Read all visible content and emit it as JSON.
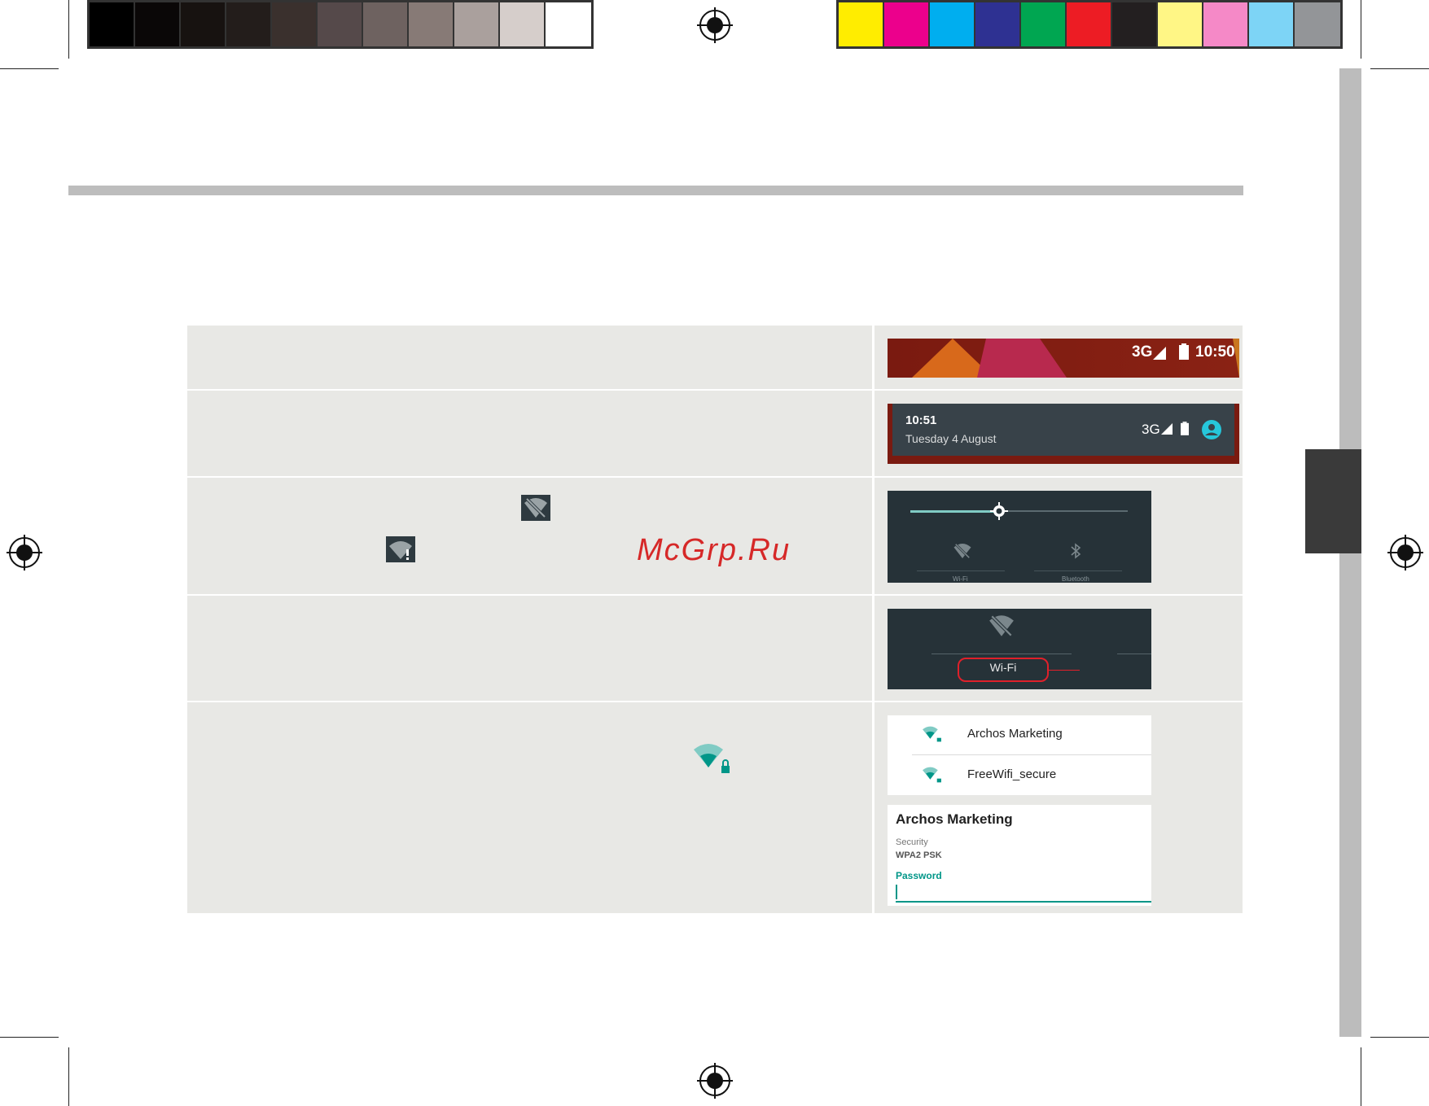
{
  "colors": {
    "grayscale_swatches": [
      "#000000",
      "#0a0707",
      "#171210",
      "#231d1b",
      "#3a302d",
      "#55494a",
      "#6e6260",
      "#877a76",
      "#aaa09d",
      "#d6cecb",
      "#ffffff"
    ],
    "color_swatches": [
      "#ffed00",
      "#ec008c",
      "#00aeef",
      "#2e3192",
      "#00a651",
      "#ed1c24",
      "#231f20",
      "#fff685",
      "#f589c7",
      "#7dd4f6",
      "#939598"
    ],
    "accent_teal": "#009688",
    "highlight_red": "#e0202a",
    "row_background": "#e8e8e5"
  },
  "watermark": "McGrp.Ru",
  "steps": [
    {
      "screenshot": "status-bar",
      "status_bar": {
        "network": "3G",
        "time": "10:50"
      }
    },
    {
      "screenshot": "notification-header",
      "notification": {
        "time": "10:51",
        "date": "Tuesday 4 August",
        "network": "3G"
      }
    },
    {
      "screenshot": "quick-settings",
      "inline_icons": [
        "wifi-off-icon",
        "wifi-alert-icon"
      ],
      "quick_settings": {
        "wifi_label": "Wi-Fi",
        "bluetooth_label": "Bluetooth",
        "brightness_level": 0.4
      }
    },
    {
      "screenshot": "wifi-tile",
      "wifi_tile": {
        "label": "Wi-Fi"
      }
    },
    {
      "screenshot": "wifi-networks",
      "inline_icons": [
        "wifi-locked-icon"
      ],
      "networks": [
        {
          "name": "Archos Marketing"
        },
        {
          "name": "FreeWifi_secure"
        }
      ],
      "dialog": {
        "title": "Archos Marketing",
        "security_label": "Security",
        "security_value": "WPA2 PSK",
        "password_label": "Password"
      }
    }
  ]
}
